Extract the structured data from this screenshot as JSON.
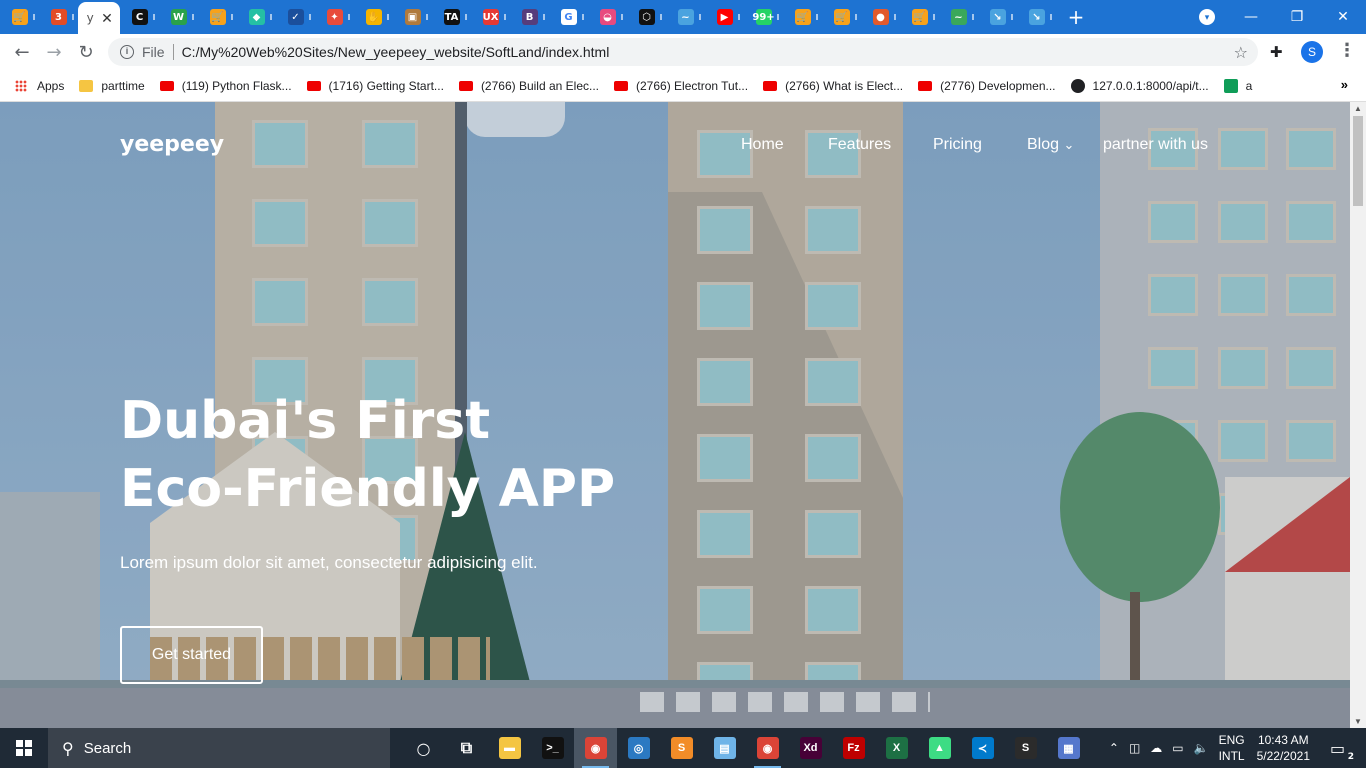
{
  "browser": {
    "tabs": [
      {
        "icon": "cart-icon",
        "color": "#f7a21b",
        "glyph": "🛒"
      },
      {
        "icon": "three-js-icon",
        "color": "#e34c26",
        "glyph": "3"
      },
      {
        "icon": "page-tab-icon",
        "active": true,
        "glyph": "y",
        "close": "✕"
      },
      {
        "icon": "codepen-c-icon",
        "color": "#111111",
        "glyph": "C"
      },
      {
        "icon": "w-icon",
        "color": "#2aa24a",
        "glyph": "W"
      },
      {
        "icon": "cart-icon",
        "color": "#f7a21b",
        "glyph": "🛒"
      },
      {
        "icon": "leaf-icon",
        "color": "#25c0a4",
        "glyph": "◆"
      },
      {
        "icon": "check-icon",
        "color": "#1b4f9c",
        "glyph": "✓"
      },
      {
        "icon": "bird-icon",
        "color": "#e84b3c",
        "glyph": "✦"
      },
      {
        "icon": "hand-icon",
        "color": "#f5b400",
        "glyph": "✋"
      },
      {
        "icon": "box-icon",
        "color": "#b07a3c",
        "glyph": "▣"
      },
      {
        "icon": "ta-icon",
        "color": "#111111",
        "glyph": "TA"
      },
      {
        "icon": "ux-icon",
        "color": "#e53935",
        "glyph": "UX"
      },
      {
        "icon": "bootstrap-b-icon",
        "color": "#563d7c",
        "glyph": "B"
      },
      {
        "icon": "google-g-icon",
        "color": "#ffffff",
        "glyph": "G"
      },
      {
        "icon": "basket-icon",
        "color": "#e84a7f",
        "glyph": "◒"
      },
      {
        "icon": "codesandbox-icon",
        "color": "#111111",
        "glyph": "⬡"
      },
      {
        "icon": "wave-icon",
        "color": "#4aa3df",
        "glyph": "~"
      },
      {
        "icon": "youtube-icon",
        "color": "#ff0000",
        "glyph": "▶"
      },
      {
        "icon": "whatsapp-icon",
        "color": "#25d366",
        "glyph": "99+"
      },
      {
        "icon": "cart-icon",
        "color": "#f7a21b",
        "glyph": "🛒"
      },
      {
        "icon": "cart-icon",
        "color": "#f7a21b",
        "glyph": "🛒"
      },
      {
        "icon": "parrot-icon",
        "color": "#e25a2c",
        "glyph": "●"
      },
      {
        "icon": "cart-icon",
        "color": "#f7a21b",
        "glyph": "🛒"
      },
      {
        "icon": "green-wave-icon",
        "color": "#3aa85a",
        "glyph": "~"
      },
      {
        "icon": "blue-arrow-icon",
        "color": "#4aa3df",
        "glyph": "↘"
      },
      {
        "icon": "blue-arrow-icon",
        "color": "#4aa3df",
        "glyph": "↘"
      }
    ],
    "new_tab": "+",
    "url_prefix": "File",
    "url": "C:/My%20Web%20Sites/New_yeepeey_website/SoftLand/index.html",
    "profile_initial": "S",
    "bookmarks": [
      {
        "type": "apps",
        "label": "Apps"
      },
      {
        "type": "folder",
        "label": "parttime"
      },
      {
        "type": "yt",
        "label": "(119) Python Flask..."
      },
      {
        "type": "yt",
        "label": "(1716) Getting Start..."
      },
      {
        "type": "yt",
        "label": "(2766) Build an Elec..."
      },
      {
        "type": "yt",
        "label": "(2766) Electron Tut..."
      },
      {
        "type": "yt",
        "label": "(2766) What is Elect..."
      },
      {
        "type": "yt",
        "label": "(2776) Developmen..."
      },
      {
        "type": "globe",
        "label": "127.0.0.1:8000/api/t..."
      },
      {
        "type": "sheet",
        "label": "a"
      }
    ],
    "bookmarks_more": "»"
  },
  "site": {
    "logo": "yeepeey",
    "nav": [
      "Home",
      "Features",
      "Pricing",
      "Blog",
      "partner with us"
    ],
    "blog_caret": "⌄",
    "hero_line1": "Dubai's First",
    "hero_line2": "Eco-Friendly APP",
    "hero_subtitle": "Lorem ipsum dolor sit amet, consectetur adipisicing elit.",
    "cta_label": "Get started"
  },
  "taskbar": {
    "search_placeholder": "Search",
    "apps": [
      {
        "name": "cortana-icon",
        "glyph": "○",
        "color": "transparent"
      },
      {
        "name": "task-view-icon",
        "glyph": "⧉",
        "color": "transparent"
      },
      {
        "name": "file-explorer-icon",
        "glyph": "▬",
        "color": "#f4c542"
      },
      {
        "name": "terminal-icon",
        "glyph": ">_",
        "color": "#111111"
      },
      {
        "name": "chrome-icon",
        "glyph": "◉",
        "color": "#db4437",
        "active": true
      },
      {
        "name": "globe-browser-icon",
        "glyph": "◎",
        "color": "#2b79c2"
      },
      {
        "name": "sublime-icon",
        "glyph": "S",
        "color": "#f28c28"
      },
      {
        "name": "notes-icon",
        "glyph": "▤",
        "color": "#6fb4e8"
      },
      {
        "name": "chrome-icon-2",
        "glyph": "◉",
        "color": "#db4437",
        "running": true
      },
      {
        "name": "adobe-xd-icon",
        "glyph": "Xd",
        "color": "#470137"
      },
      {
        "name": "filezilla-icon",
        "glyph": "Fz",
        "color": "#bf0000"
      },
      {
        "name": "excel-icon",
        "glyph": "X",
        "color": "#1d7044"
      },
      {
        "name": "android-studio-icon",
        "glyph": "▲",
        "color": "#3ddc84"
      },
      {
        "name": "vscode-icon",
        "glyph": "≺",
        "color": "#007acc"
      },
      {
        "name": "s-app-icon",
        "glyph": "S",
        "color": "#2b2b2b"
      },
      {
        "name": "network-app-icon",
        "glyph": "▦",
        "color": "#5577cc"
      }
    ],
    "lang_1": "ENG",
    "lang_2": "INTL",
    "time": "10:43 AM",
    "date": "5/22/2021",
    "notification_count": "2"
  }
}
